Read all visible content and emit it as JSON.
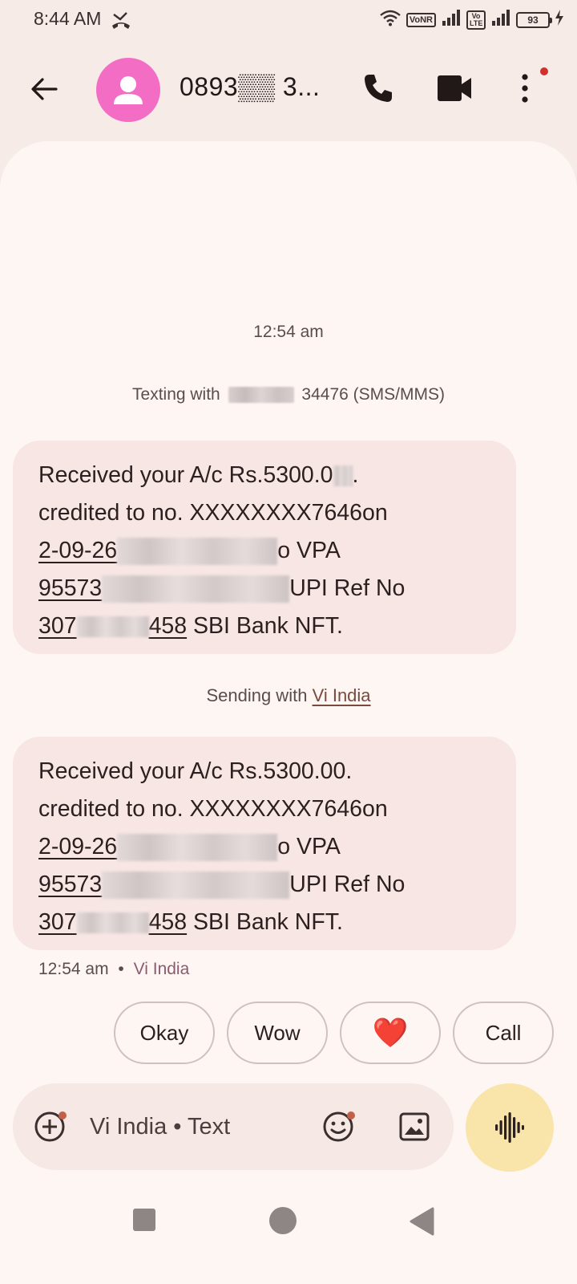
{
  "status_bar": {
    "time": "8:44 AM",
    "vonr_label": "VoNR",
    "volte_label": "Vo LTE",
    "battery": "93"
  },
  "header": {
    "contact_name": "0893▒▒ 3...",
    "icons": [
      "back-arrow-icon",
      "avatar-person-icon",
      "phone-icon",
      "video-call-icon",
      "more-vert-icon"
    ]
  },
  "conversation": {
    "date_label": "12:54 am",
    "texting_with_prefix": "Texting with",
    "texting_with_suffix": "34476 (SMS/MMS)",
    "messages": [
      {
        "line1": "Received your A/c Rs.5300.0",
        "line1_end": ".",
        "line2": "credited to no. XXXXXXXX7646on",
        "line3_start": "2-09-26",
        "line3_end": "o VPA",
        "line4_start": "95573",
        "line4_end": "UPI Ref No",
        "line5_start": "307",
        "line5_mid": "458",
        "line5_end": " SBI Bank NFT."
      },
      {
        "line1": "Received your A/c Rs.5300.00.",
        "line2": "credited to no. XXXXXXXX7646on",
        "line3_start": "2-09-26",
        "line3_end": "o VPA",
        "line4_start": "95573",
        "line4_end": "UPI Ref No",
        "line5_start": "307",
        "line5_mid": "458",
        "line5_end": " SBI Bank NFT."
      }
    ],
    "sending_prefix": "Sending with",
    "sending_carrier": "Vi India",
    "meta_time": "12:54 am",
    "meta_sep": "•",
    "meta_carrier": "Vi India"
  },
  "suggestions": [
    "Okay",
    "Wow",
    "❤️",
    "Call"
  ],
  "compose": {
    "placeholder": "Vi India • Text"
  },
  "colors": {
    "accent_avatar": "#f36dc5",
    "bubble": "#f7e6e4",
    "mic_fab": "#f9e4a9",
    "background": "#f7ebe8"
  }
}
